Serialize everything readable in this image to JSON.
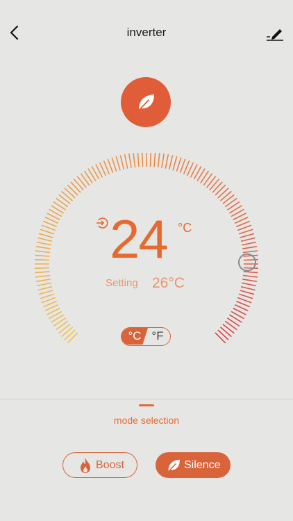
{
  "header": {
    "title": "inverter",
    "back_icon": "chevron-left-icon",
    "edit_icon": "pencil-icon"
  },
  "mode_icon": "leaf-icon",
  "thermostat": {
    "current_temp": "24",
    "current_unit": "°C",
    "setting_label": "Setting",
    "setting_value": "26°C",
    "dial_level": 0.83,
    "unit_toggle": {
      "celsius": "°C",
      "fahrenheit": "°F",
      "selected": "celsius"
    }
  },
  "mode_selection": {
    "label": "mode selection",
    "buttons": [
      {
        "label": "Boost",
        "icon": "flame-icon",
        "selected": false
      },
      {
        "label": "Silence",
        "icon": "leaf-icon",
        "selected": true
      }
    ]
  },
  "colors": {
    "accent": "#e15c38",
    "text_orange": "#e66a2f",
    "background": "#e6e6e5",
    "dial_start": "#f0c24f",
    "dial_end": "#d8454b"
  }
}
